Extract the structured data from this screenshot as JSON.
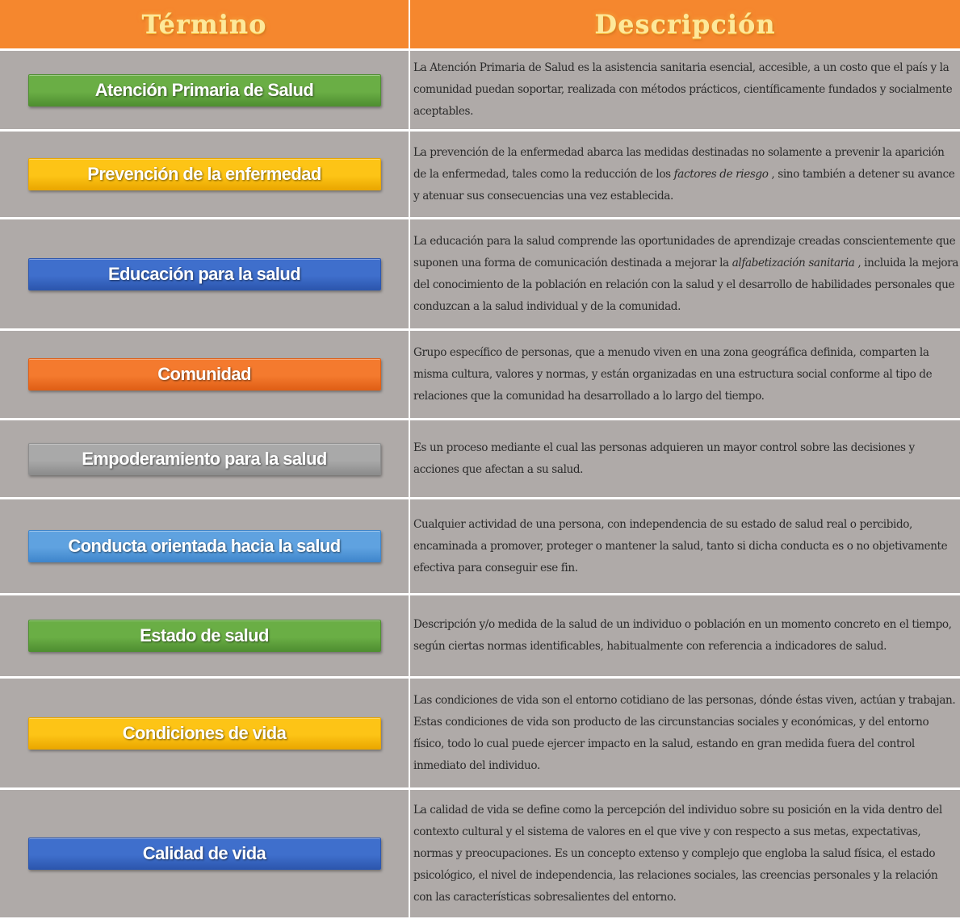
{
  "header": {
    "term_title": "Término",
    "desc_title": "Descripción"
  },
  "rows": [
    {
      "term": "Atención Primaria de Salud",
      "color": "#6aae45",
      "color_dark": "#4f8f31",
      "desc": "La Atención Primaria de Salud es la asistencia sanitaria esencial, accesible, a un costo que el país y la comunidad puedan soportar, realizada con métodos prácticos, científicamente fundados y socialmente aceptables."
    },
    {
      "term": "Prevención de la enfermedad",
      "color": "#fdc416",
      "color_dark": "#eaa700",
      "desc_before": "La prevención de la enfermedad abarca las medidas destinadas no solamente a prevenir la aparición de la enfermedad, tales como la reducción de los ",
      "desc_em": "factores de riesgo",
      "desc_after": " , sino también a detener su avance y atenuar sus consecuencias una vez establecida."
    },
    {
      "term": "Educación para la salud",
      "color": "#3f6fcc",
      "color_dark": "#2c56ae",
      "desc_before": "La educación para la salud comprende las oportunidades de aprendizaje creadas conscientemente que suponen una forma de comunicación destinada a mejorar la ",
      "desc_em": "alfabetización sanitaria",
      "desc_after": " , incluida la mejora del conocimiento de la población en relación con la salud y el desarrollo de habilidades personales que conduzcan a la salud individual y de la comunidad."
    },
    {
      "term": "Comunidad",
      "color": "#f47a2e",
      "color_dark": "#e05f16",
      "desc": "Grupo específico de personas, que a menudo viven en una zona geográfica definida, comparten la misma cultura, valores y normas, y están organizadas en una estructura social conforme al tipo de relaciones que la comunidad ha desarrollado a lo largo del tiempo."
    },
    {
      "term": "Empoderamiento para la salud",
      "color": "#a9a9a9",
      "color_dark": "#8c8c8c",
      "desc": "Es un proceso mediante el cual las personas adquieren un mayor control sobre las decisiones y acciones que afectan a su salud."
    },
    {
      "term": "Conducta orientada hacia la salud",
      "color": "#5fa2e0",
      "color_dark": "#3f86cc",
      "desc": "Cualquier actividad de una persona, con independencia de su estado de salud real o percibido, encaminada a promover, proteger o mantener la salud, tanto si dicha conducta es o no objetivamente efectiva para conseguir ese fin."
    },
    {
      "term": "Estado de salud",
      "color": "#6aae45",
      "color_dark": "#4f8f31",
      "desc": "Descripción y/o medida de la salud de un individuo o población en un momento concreto en el tiempo, según ciertas normas identificables, habitualmente con referencia a indicadores de salud."
    },
    {
      "term": "Condiciones de vida",
      "color": "#fdc416",
      "color_dark": "#eaa700",
      "desc": "Las condiciones de vida son el entorno cotidiano de las personas, dónde éstas viven, actúan y trabajan.  Estas condiciones de vida son producto de las circunstancias sociales y económicas, y del entorno físico, todo lo cual puede ejercer impacto en la salud, estando en gran medida fuera del control inmediato del individuo."
    },
    {
      "term": "Calidad de vida",
      "color": "#3f6fcc",
      "color_dark": "#2c56ae",
      "desc": "La calidad de vida se define como la percepción del individuo sobre su posición en la vida dentro del contexto cultural y el sistema de valores en el que vive y con respecto a sus metas, expectativas, normas y preocupaciones. Es un concepto extenso y complejo que engloba la salud física, el estado psicológico, el nivel de independencia, las relaciones sociales, las creencias personales y la relación con las características sobresalientes del entorno."
    }
  ]
}
